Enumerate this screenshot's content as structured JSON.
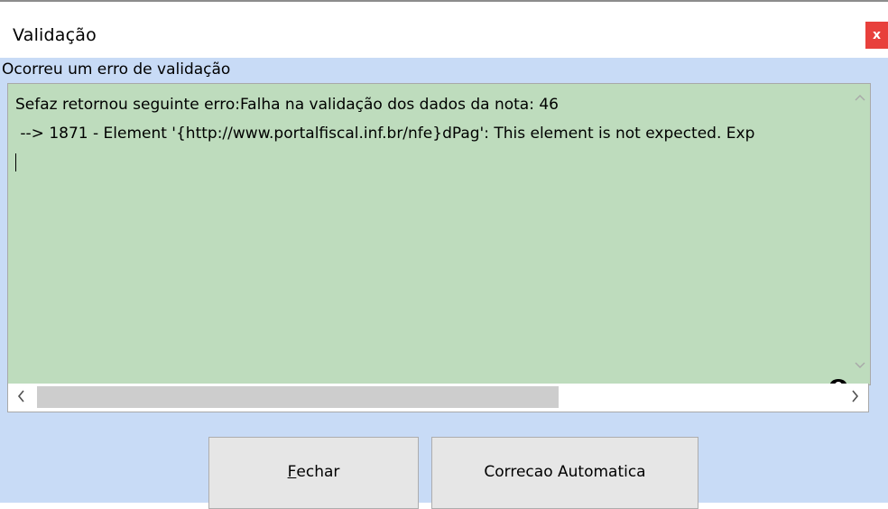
{
  "window": {
    "title": "Validação",
    "close_label": "x"
  },
  "dialog": {
    "caption": "Ocorreu um erro de validação",
    "message_line1": "Sefaz retornou seguinte erro:Falha na validação dos dados da nota: 46",
    "message_line2": " --> 1871 - Element '{http://www.portalfiscal.inf.br/nfe}dPag': This element is not expected. Exp"
  },
  "buttons": {
    "fechar_mnemonic": "F",
    "fechar_rest": "echar",
    "correcao_label": "Correcao Automatica"
  },
  "icons": {
    "reveal": "eye-icon",
    "scroll_up": "chevron-up-icon",
    "scroll_down": "chevron-down-icon",
    "scroll_left": "chevron-left-icon",
    "scroll_right": "chevron-right-icon"
  },
  "colors": {
    "text_panel_bg": "#bedcbd",
    "dialog_bg": "#c8dbf6",
    "close_button": "#e8403c"
  }
}
